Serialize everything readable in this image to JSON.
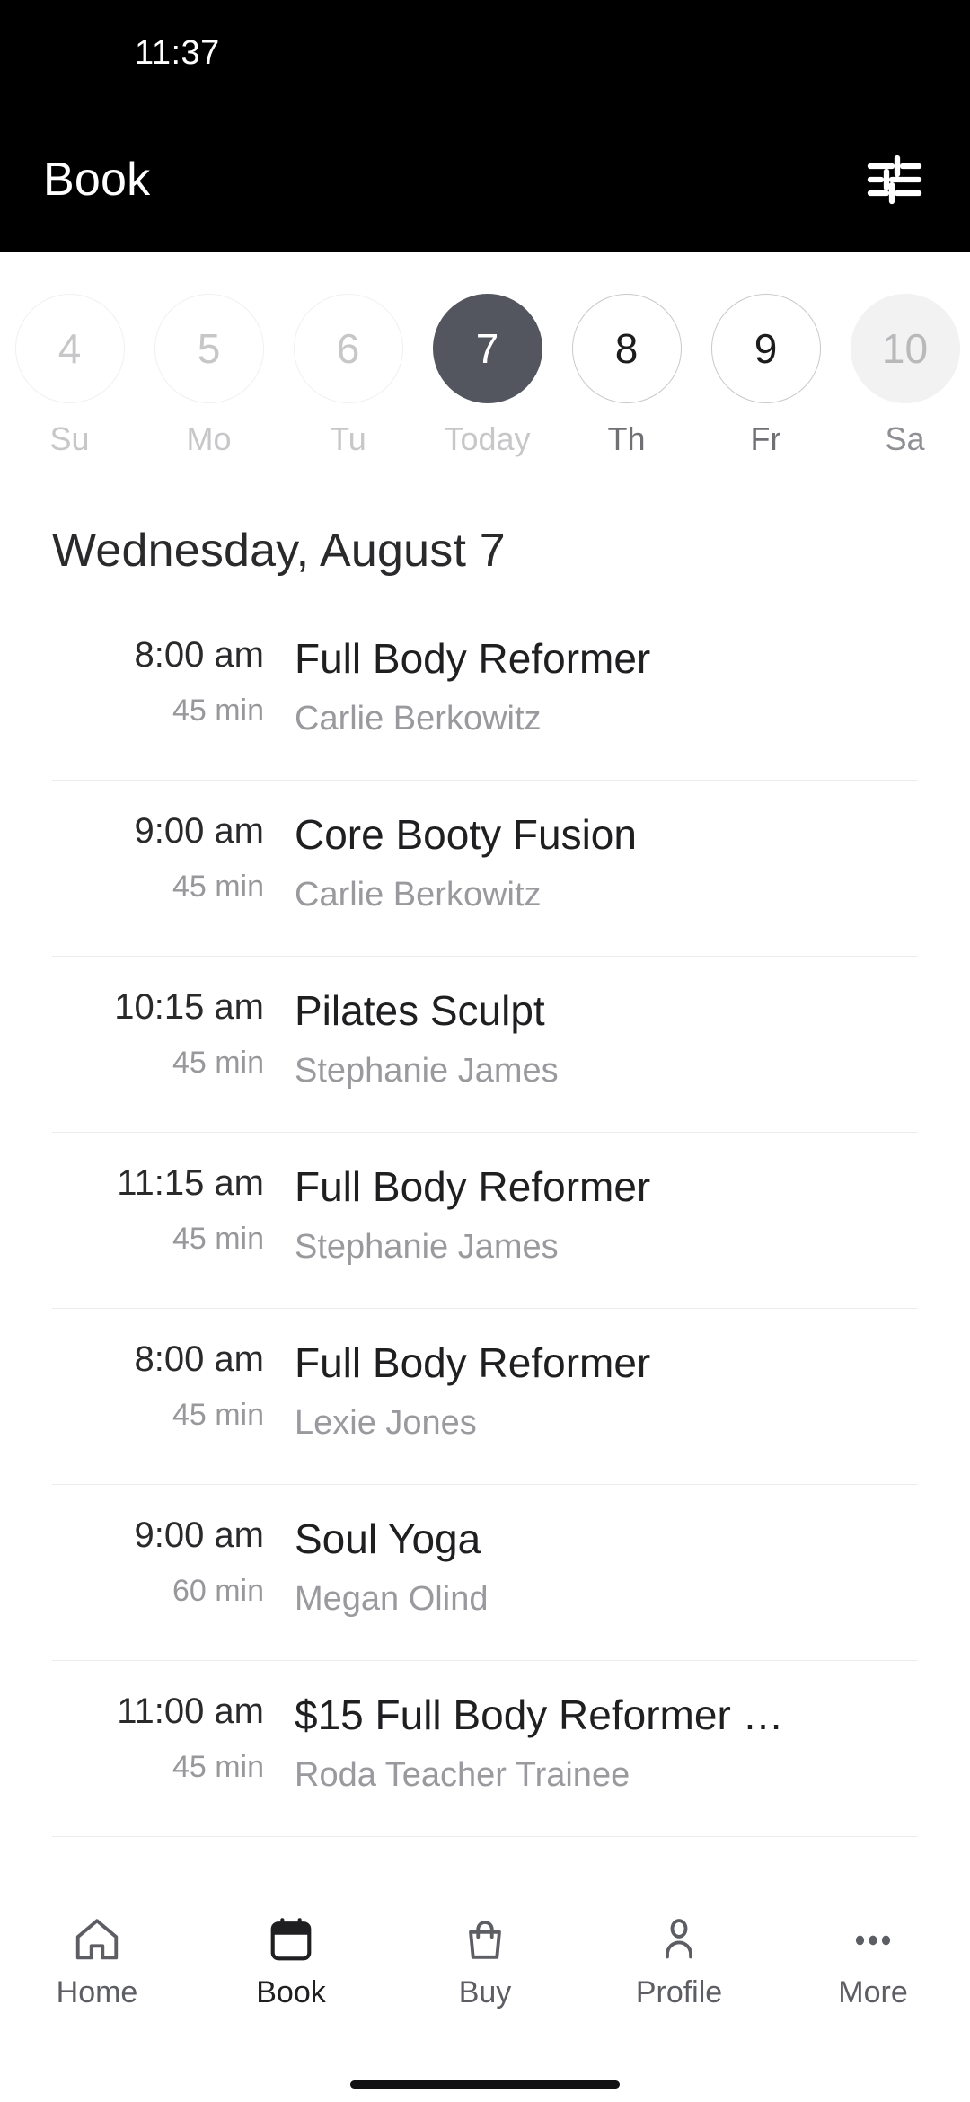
{
  "status_bar": {
    "time": "11:37"
  },
  "app_bar": {
    "title": "Book",
    "filter_icon": "tune-icon"
  },
  "date_strip": {
    "days": [
      {
        "day_number": "4",
        "label": "Su",
        "state": "disabled"
      },
      {
        "day_number": "5",
        "label": "Mo",
        "state": "disabled"
      },
      {
        "day_number": "6",
        "label": "Tu",
        "state": "disabled"
      },
      {
        "day_number": "7",
        "label": "Today",
        "state": "selected"
      },
      {
        "day_number": "8",
        "label": "Th",
        "state": "active"
      },
      {
        "day_number": "9",
        "label": "Fr",
        "state": "active"
      },
      {
        "day_number": "10",
        "label": "Sa",
        "state": "faded"
      }
    ]
  },
  "day_heading": "Wednesday, August 7",
  "classes": [
    {
      "time": "8:00 am",
      "duration": "45 min",
      "title": "Full Body Reformer",
      "instructor": "Carlie Berkowitz"
    },
    {
      "time": "9:00 am",
      "duration": "45 min",
      "title": "Core Booty Fusion",
      "instructor": "Carlie Berkowitz"
    },
    {
      "time": "10:15 am",
      "duration": "45 min",
      "title": "Pilates Sculpt",
      "instructor": "Stephanie James"
    },
    {
      "time": "11:15 am",
      "duration": "45 min",
      "title": "Full Body Reformer",
      "instructor": "Stephanie James"
    },
    {
      "time": "8:00 am",
      "duration": "45 min",
      "title": "Full Body Reformer",
      "instructor": "Lexie Jones"
    },
    {
      "time": "9:00 am",
      "duration": "60 min",
      "title": "Soul Yoga",
      "instructor": "Megan Olind"
    },
    {
      "time": "11:00 am",
      "duration": "45 min",
      "title": "$15 Full Body Reformer …",
      "instructor": "Roda Teacher Trainee"
    }
  ],
  "bottom_nav": {
    "items": [
      {
        "label": "Home",
        "icon": "home-icon",
        "active": false
      },
      {
        "label": "Book",
        "icon": "calendar-icon",
        "active": true
      },
      {
        "label": "Buy",
        "icon": "bag-icon",
        "active": false
      },
      {
        "label": "Profile",
        "icon": "person-icon",
        "active": false
      },
      {
        "label": "More",
        "icon": "ellipsis-icon",
        "active": false
      }
    ]
  },
  "colors": {
    "header_background": "#000000",
    "selected_day_fill": "#53565f",
    "page_background": "#ffffff",
    "divider": "#ececed",
    "primary_text": "#1f1f21",
    "secondary_text": "#9a9a9e"
  }
}
